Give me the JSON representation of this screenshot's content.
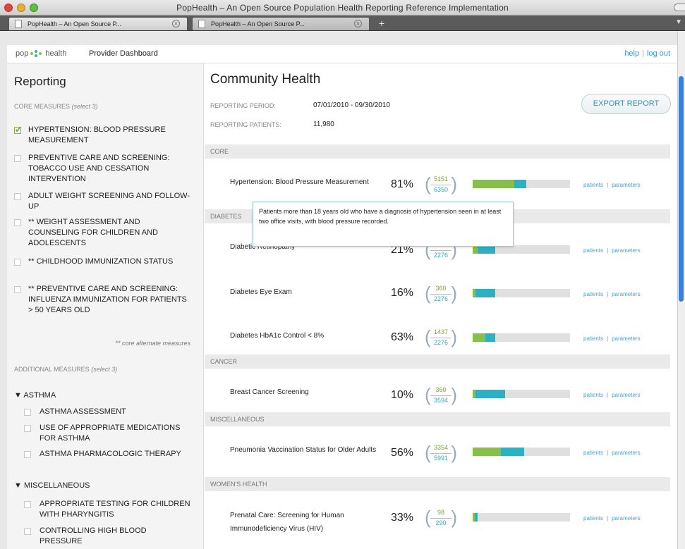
{
  "window": {
    "title": "PopHealth – An Open Source Population Health Reporting Reference Implementation",
    "tabs": [
      {
        "label": "PopHealth – An Open Source P..."
      },
      {
        "label": "PopHealth – An Open Source P..."
      }
    ],
    "new_tab": "+"
  },
  "header": {
    "logo_left": "pop",
    "logo_right": "health",
    "app_name": "Provider Dashboard",
    "links": {
      "help": "help",
      "logout": "log out"
    }
  },
  "sidebar": {
    "title": "Reporting",
    "core_label": "CORE MEASURES",
    "core_hint": "(select 3)",
    "core_items": [
      {
        "label": "HYPERTENSION: BLOOD PRESSURE MEASUREMENT",
        "checked": true
      },
      {
        "label": "PREVENTIVE CARE AND SCREENING: TOBACCO USE AND CESSATION INTERVENTION",
        "checked": false
      },
      {
        "label": "ADULT WEIGHT SCREENING AND FOLLOW-UP",
        "checked": false
      },
      {
        "label": "** WEIGHT ASSESSMENT AND COUNSELING FOR CHILDREN AND ADOLESCENTS",
        "checked": false
      },
      {
        "label": "** CHILDHOOD IMMUNIZATION STATUS",
        "checked": false
      },
      {
        "label": "** PREVENTIVE CARE AND SCREENING: INFLUENZA IMMUNIZATION FOR PATIENTS > 50 YEARS OLD",
        "checked": false
      }
    ],
    "alt_note": "** core alternate measures",
    "additional_label": "ADDITIONAL MEASURES",
    "additional_hint": "(select 3)",
    "groups": [
      {
        "name": "▼ ASTHMA",
        "items": [
          "ASTHMA ASSESSMENT",
          "USE OF APPROPRIATE MEDICATIONS FOR ASTHMA",
          "ASTHMA PHARMACOLOGIC THERAPY"
        ]
      },
      {
        "name": "▼ MISCELLANEOUS",
        "items": [
          "APPROPRIATE TESTING FOR CHILDREN WITH PHARYNGITIS",
          "CONTROLLING HIGH BLOOD PRESSURE"
        ]
      }
    ]
  },
  "main": {
    "title": "Community Health",
    "reporting_period_label": "REPORTING PERIOD:",
    "reporting_period": "07/01/2010 - 09/30/2010",
    "reporting_patients_label": "REPORTING PATIENTS:",
    "reporting_patients": "11,980",
    "export_label": "EXPORT REPORT",
    "link_patients": "patients",
    "link_parameters": "parameters",
    "sections": [
      "CORE",
      "DIABETES",
      "CANCER",
      "MISCELLANEOUS",
      "WOMEN'S HEALTH"
    ],
    "measures": [
      {
        "name": "Hypertension: Blood Pressure Measurement",
        "pct": "81%",
        "num": "5151",
        "den": "6350",
        "num_frac": 0.43,
        "den_frac": 0.55
      },
      {
        "name": "Diabetic Retinopathy",
        "pct": "21%",
        "num": "",
        "den": "2276",
        "num_frac": 0.05,
        "den_frac": 0.23
      },
      {
        "name": "Diabetes Eye Exam",
        "pct": "16%",
        "num": "360",
        "den": "2276",
        "num_frac": 0.03,
        "den_frac": 0.23
      },
      {
        "name": "Diabetes HbA1c Control < 8%",
        "pct": "63%",
        "num": "1437",
        "den": "2276",
        "num_frac": 0.13,
        "den_frac": 0.23
      },
      {
        "name": "Breast Cancer Screening",
        "pct": "10%",
        "num": "360",
        "den": "3594",
        "num_frac": 0.03,
        "den_frac": 0.33
      },
      {
        "name": "Pneumonia Vaccination Status for Older Adults",
        "pct": "56%",
        "num": "3354",
        "den": "5991",
        "num_frac": 0.29,
        "den_frac": 0.53
      },
      {
        "name": "Prenatal Care: Screening for Human Immunodeficiency Virus (HIV)",
        "pct": "33%",
        "num": "98",
        "den": "290",
        "num_frac": 0.02,
        "den_frac": 0.05
      }
    ],
    "tooltip": "Patients more than 18 years old who have a diagnosis of hypertension seen in at least two office visits, with blood pressure recorded."
  }
}
